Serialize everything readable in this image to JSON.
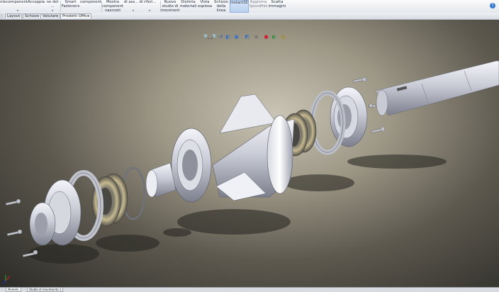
{
  "ribbon": {
    "commands": [
      {
        "label": "nte"
      },
      {
        "label": "componenti"
      },
      {
        "label": "Accoppia"
      },
      {
        "label": "ne del ..."
      },
      {
        "label": "Smart\nFasteners"
      },
      {
        "label": "componente"
      },
      {
        "label": "Mostra\ncomponenti\nnascosti"
      },
      {
        "label": "di ass..."
      },
      {
        "label": "di riferi..."
      },
      {
        "label": "Nuovo\nstudio di\nmovimento"
      },
      {
        "label": "Distinta\nmateriali"
      },
      {
        "label": "Vista\nesplosa"
      },
      {
        "label": "Schizzo\ndella\nlinea di..."
      },
      {
        "label": "Instant3D"
      },
      {
        "label": "Aggiorna\nSpeedPak"
      },
      {
        "label": "Scatta\nimmagini"
      }
    ]
  },
  "tabs": [
    "Layout",
    "Schizzo",
    "Valutare",
    "Prodotti Office"
  ],
  "heads_up_icons": [
    "zoom-to-fit-icon",
    "zoom-area-icon",
    "previous-view-icon",
    "section-view-icon",
    "view-orientation-icon",
    "display-style-icon",
    "hide-show-icon",
    "edit-appearance-icon",
    "apply-scene-icon",
    "view-settings-icon"
  ],
  "status_tabs": [
    "Modello",
    "Studio di movimento 1"
  ],
  "colors": {
    "accent": "#b9d0ee",
    "ribbon_bg": "#eef0f3"
  }
}
